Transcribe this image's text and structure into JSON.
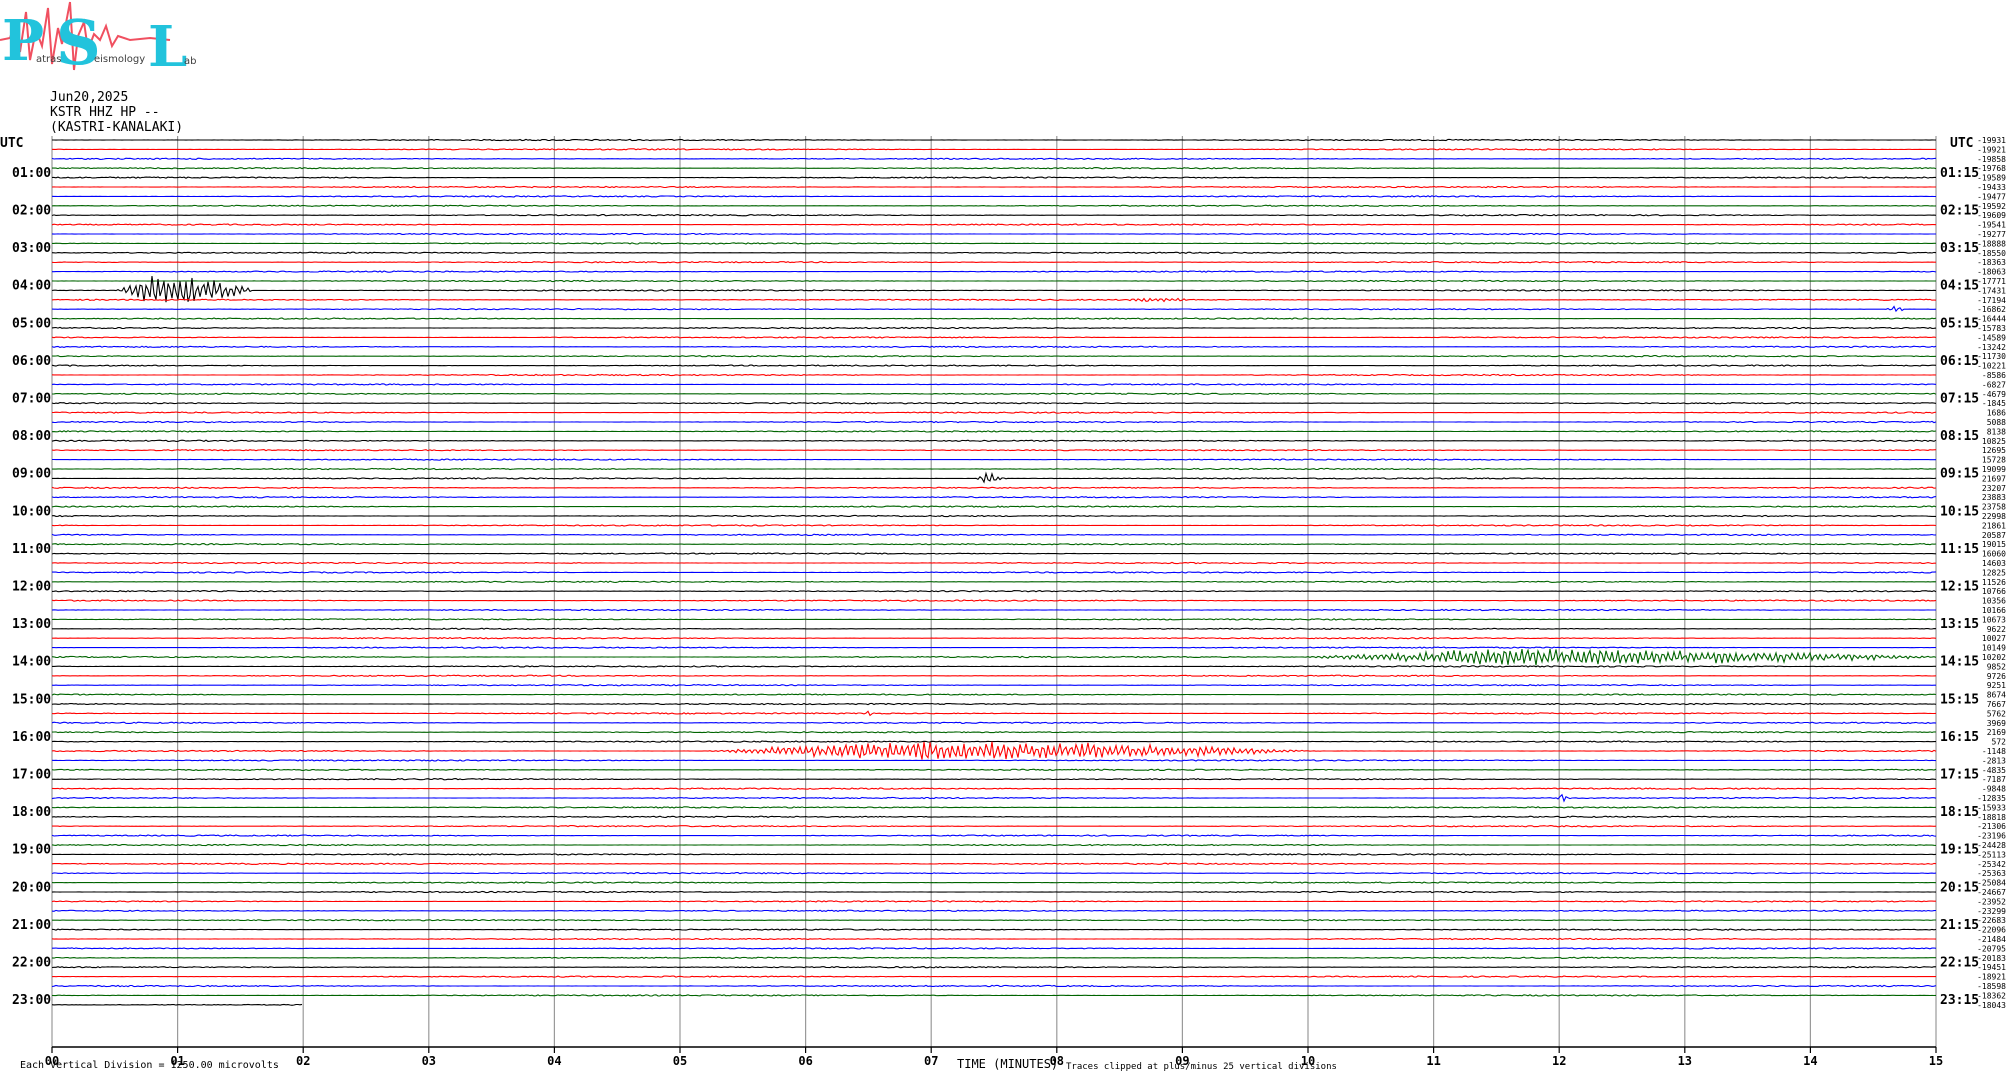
{
  "logo": {
    "letters": [
      "P",
      "S",
      "L"
    ],
    "small_words": [
      "atras",
      "eismology",
      "ab"
    ],
    "colors": {
      "letters": "#22c3dc",
      "wave": "#f05060",
      "small": "#404040"
    }
  },
  "header": {
    "date": "Jun20,2025",
    "channel": "KSTR HHZ HP --",
    "station": "(KASTRI-KANALAKI)"
  },
  "axis": {
    "left_title": "UTC",
    "right_title": "UTC",
    "xlabel": "TIME (MINUTES)",
    "x_ticks": [
      "00",
      "01",
      "02",
      "03",
      "04",
      "05",
      "06",
      "07",
      "08",
      "09",
      "10",
      "11",
      "12",
      "13",
      "14",
      "15"
    ],
    "left_hours": [
      "01:00",
      "02:00",
      "03:00",
      "04:00",
      "05:00",
      "06:00",
      "07:00",
      "08:00",
      "09:00",
      "10:00",
      "11:00",
      "12:00",
      "13:00",
      "14:00",
      "15:00",
      "16:00",
      "17:00",
      "18:00",
      "19:00",
      "20:00",
      "21:00",
      "22:00",
      "23:00"
    ],
    "right_hours": [
      "01:15",
      "02:15",
      "03:15",
      "04:15",
      "05:15",
      "06:15",
      "07:15",
      "08:15",
      "09:15",
      "10:15",
      "11:15",
      "12:15",
      "13:15",
      "14:15",
      "15:15",
      "16:15",
      "17:15",
      "18:15",
      "19:15",
      "20:15",
      "21:15",
      "22:15",
      "23:15"
    ]
  },
  "footer": {
    "left": "Each Vertical Division = 1250.00 microvolts",
    "right": "Traces clipped at plus/minus 25 vertical divisions"
  },
  "chart_data": {
    "type": "line",
    "xlabel": "TIME (MINUTES)",
    "xlim": [
      0,
      15
    ],
    "colors": [
      "#000000",
      "#ff0000",
      "#0000ff",
      "#006400"
    ],
    "traces_per_hour": 4,
    "minutes_per_trace": 15,
    "trace_count": 93,
    "last_trace_end_minute": 2,
    "offsets": [
      -19931,
      -19921,
      -19858,
      -19768,
      -19589,
      -19433,
      -19477,
      -19592,
      -19609,
      -19541,
      -19277,
      -18888,
      -18550,
      -18363,
      -18063,
      -17771,
      -17431,
      -17194,
      -16862,
      -16444,
      -15783,
      -14589,
      -13242,
      -11730,
      -10221,
      -8586,
      -6827,
      -4679,
      -1845,
      1686,
      5088,
      8138,
      10825,
      12695,
      15728,
      19099,
      21697,
      23207,
      23883,
      23758,
      22998,
      21861,
      20587,
      19015,
      16060,
      14603,
      12825,
      11526,
      10766,
      10356,
      10166,
      10673,
      9622,
      10027,
      10149,
      10202,
      9852,
      9726,
      9251,
      8674,
      7667,
      5762,
      3969,
      2169,
      572,
      -1148,
      -2813,
      -4835,
      -7187,
      -9848,
      -12835,
      -15933,
      -18818,
      -21306,
      -23196,
      -24428,
      -25113,
      -25342,
      -25363,
      -25084,
      -24667,
      -23952,
      -23299,
      -22683,
      -22096,
      -21484,
      -20795,
      -20183,
      -19451,
      -18921,
      -18598,
      -18362,
      -18043
    ],
    "events": [
      {
        "trace": 16,
        "start_min": 0.5,
        "end_min": 1.6,
        "peak_min": 1.0,
        "amp": 2.2
      },
      {
        "trace": 17,
        "start_min": 8.5,
        "end_min": 9.1,
        "peak_min": 8.8,
        "amp": 0.3
      },
      {
        "trace": 18,
        "start_min": 14.6,
        "end_min": 14.75,
        "peak_min": 14.7,
        "amp": 0.35
      },
      {
        "trace": 36,
        "start_min": 7.35,
        "end_min": 7.6,
        "peak_min": 7.45,
        "amp": 0.7
      },
      {
        "trace": 55,
        "start_min": 9.9,
        "end_min": 15.0,
        "peak_min": 12.3,
        "amp": 1.1
      },
      {
        "trace": 65,
        "start_min": 5.2,
        "end_min": 10.0,
        "peak_min": 7.4,
        "amp": 1.3
      },
      {
        "trace": 61,
        "start_min": 6.48,
        "end_min": 6.55,
        "peak_min": 6.52,
        "amp": 0.45
      },
      {
        "trace": 70,
        "start_min": 11.98,
        "end_min": 12.1,
        "peak_min": 12.02,
        "amp": 0.6
      }
    ]
  }
}
